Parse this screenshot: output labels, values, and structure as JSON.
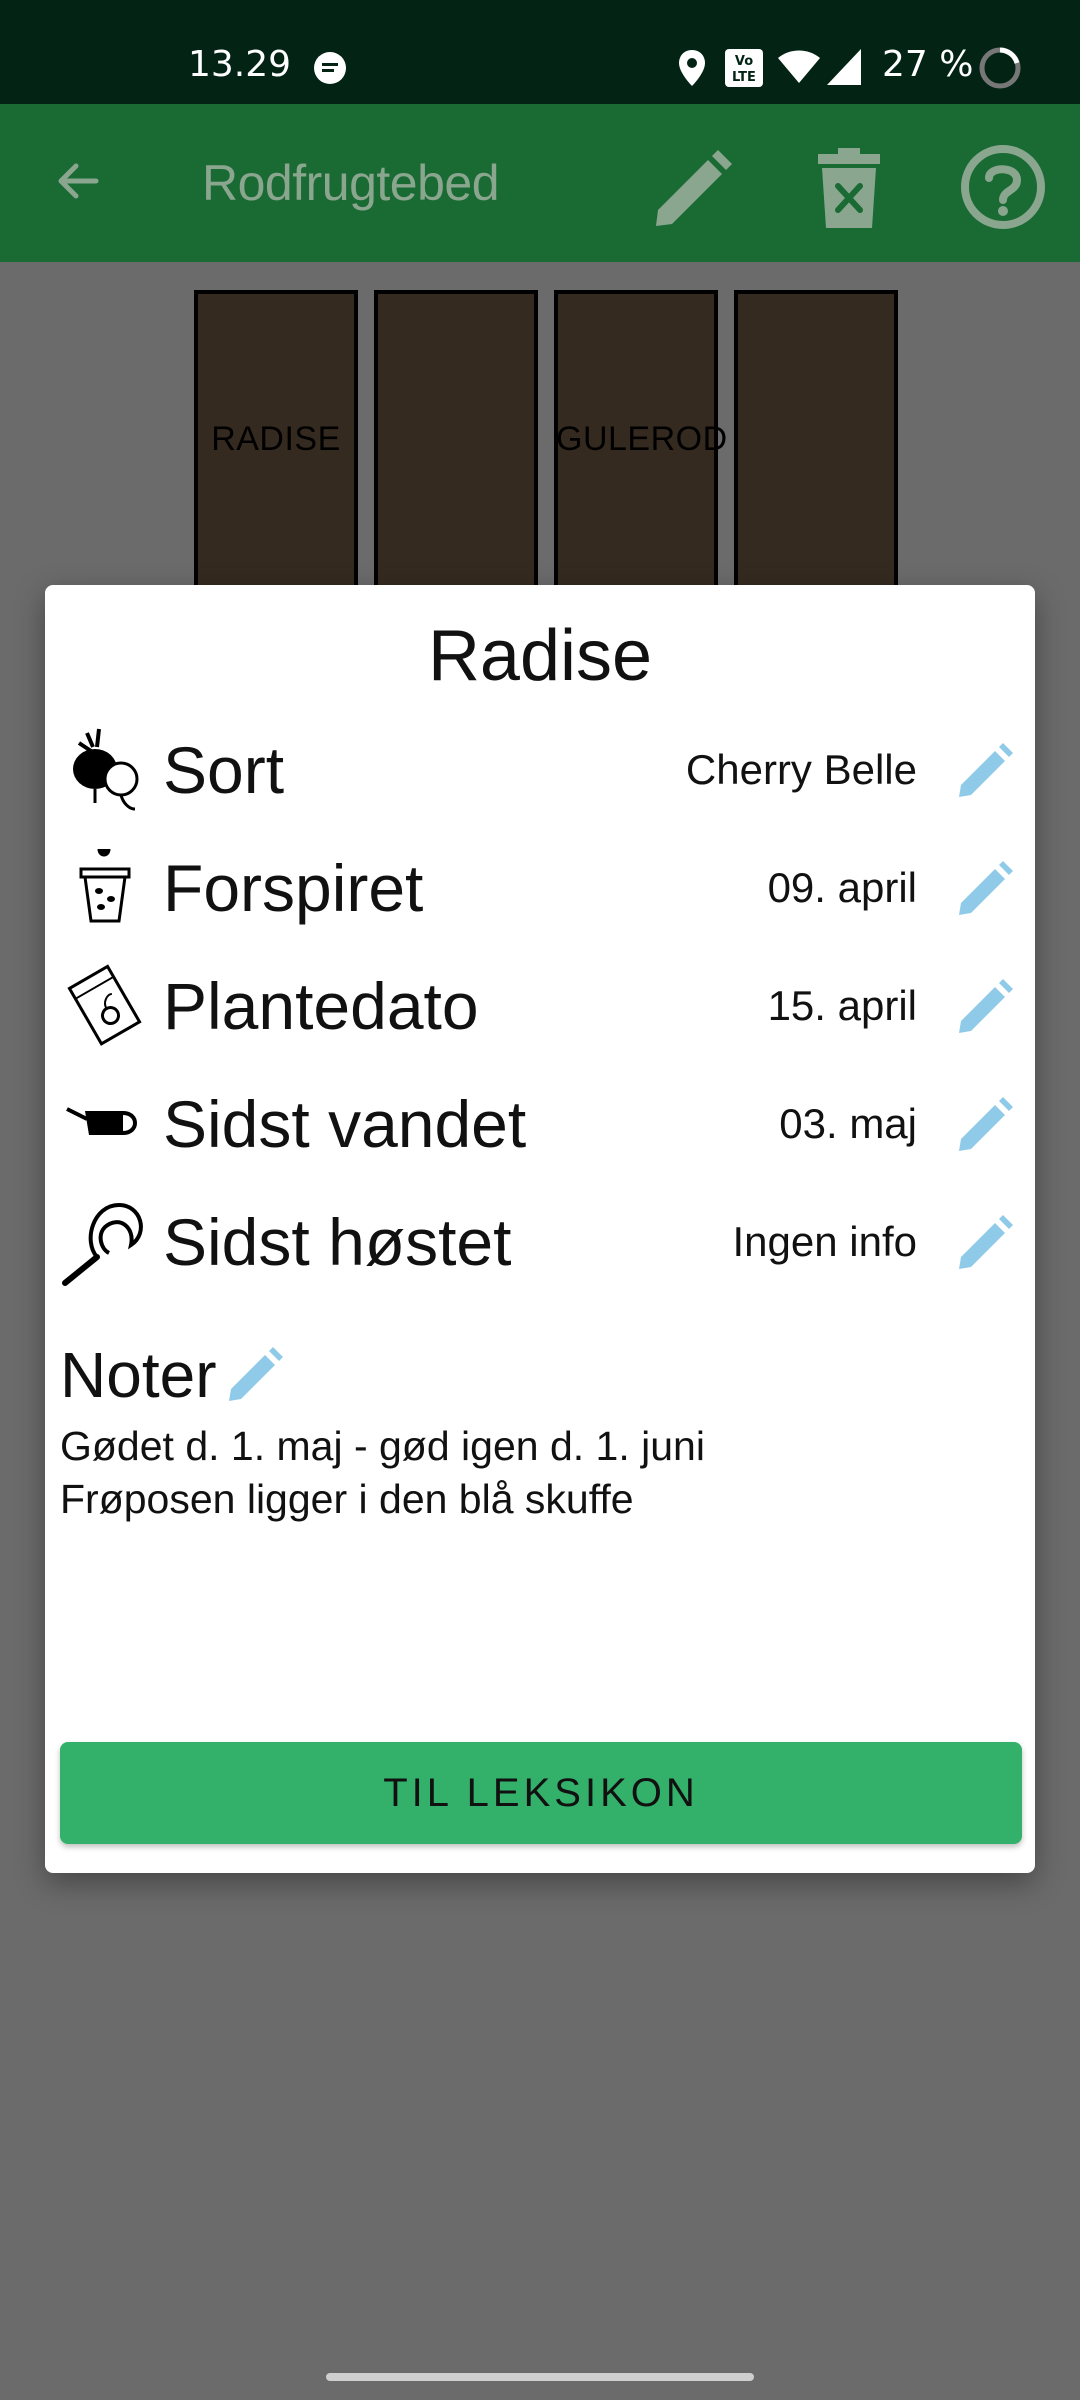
{
  "status_bar": {
    "time": "13.29",
    "battery": "27 %",
    "icons": [
      "message-icon",
      "location-icon",
      "volte-icon",
      "wifi-icon",
      "signal-icon",
      "battery-ring-icon"
    ]
  },
  "app_bar": {
    "title": "Rodfrugtebed",
    "icons": [
      "back-arrow-icon",
      "edit-icon",
      "delete-icon",
      "help-icon"
    ],
    "color": "#1a6b33"
  },
  "beds": [
    {
      "label": "RADISE"
    },
    {
      "label": ""
    },
    {
      "label": "GULEROD"
    },
    {
      "label": ""
    }
  ],
  "dialog": {
    "title": "Radise",
    "rows": [
      {
        "icon": "radish-icon",
        "label": "Sort",
        "value": "Cherry Belle"
      },
      {
        "icon": "seed-pot-icon",
        "label": "Forspiret",
        "value": "09. april"
      },
      {
        "icon": "seed-packet-icon",
        "label": "Plantedato",
        "value": "15. april"
      },
      {
        "icon": "watering-can-icon",
        "label": "Sidst vandet",
        "value": "03. maj"
      },
      {
        "icon": "sickle-icon",
        "label": "Sidst høstet",
        "value": "Ingen info"
      }
    ],
    "notes": {
      "title": "Noter",
      "lines": [
        "Gødet d. 1. maj - gød igen d. 1. juni",
        "Frøposen ligger i den blå skuffe"
      ]
    },
    "button_label": "TIL LEKSIKON",
    "accent_color": "#33b06a",
    "edit_icon_color": "#8fcbe8"
  }
}
